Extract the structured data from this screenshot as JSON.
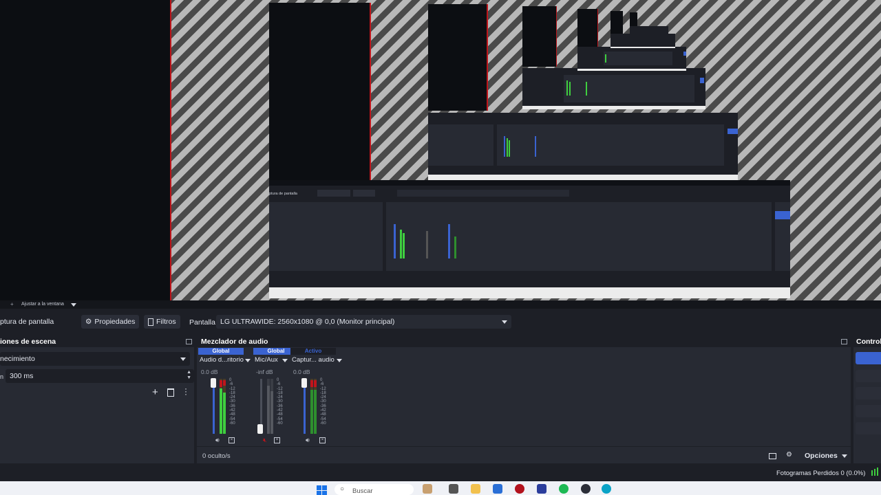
{
  "preview": {
    "context_label": "Ajustar a la ventana"
  },
  "toolbar": {
    "source_name": "ptura de pantalla",
    "properties_label": "Propiedades",
    "filters_label": "Filtros",
    "display_label": "Pantalla",
    "display_value": "LG ULTRAWIDE: 2560x1080 @ 0,0 (Monitor principal)"
  },
  "transitions": {
    "title": "iones de escena",
    "transition_value": "necimiento",
    "duration_value": "300 ms"
  },
  "mixer": {
    "title": "Mezclador de audio",
    "channels": [
      {
        "tag": "Global",
        "tag_color": "#3a63d1",
        "name": "Audio d...ritorio",
        "db": "0.0 dB"
      },
      {
        "tag": "Global",
        "tag_color": "#3a63d1",
        "name": "Mic/Aux",
        "db": "-inf dB"
      },
      {
        "tag": "Activo",
        "tag_color": "#1d1f26",
        "name": "Captur... audio",
        "db": "0.0 dB"
      }
    ],
    "ticks": [
      "0",
      "-6",
      "-12",
      "-18",
      "-24",
      "-30",
      "-36",
      "-42",
      "-48",
      "-54",
      "-60"
    ],
    "hidden_count": "0 oculto/s",
    "options_label": "Opciones"
  },
  "controls": {
    "title": "Control"
  },
  "status": {
    "dropped_frames": "Fotogramas Perdidos 0 (0.0%)"
  },
  "taskbar": {
    "search_placeholder": "Buscar"
  },
  "colors": {
    "accent_blue": "#3a63d1",
    "meter_green": "#3fcf3f",
    "meter_red": "#c0151b",
    "panel_bg": "#272a33",
    "dock_bg": "#1d1f26"
  }
}
